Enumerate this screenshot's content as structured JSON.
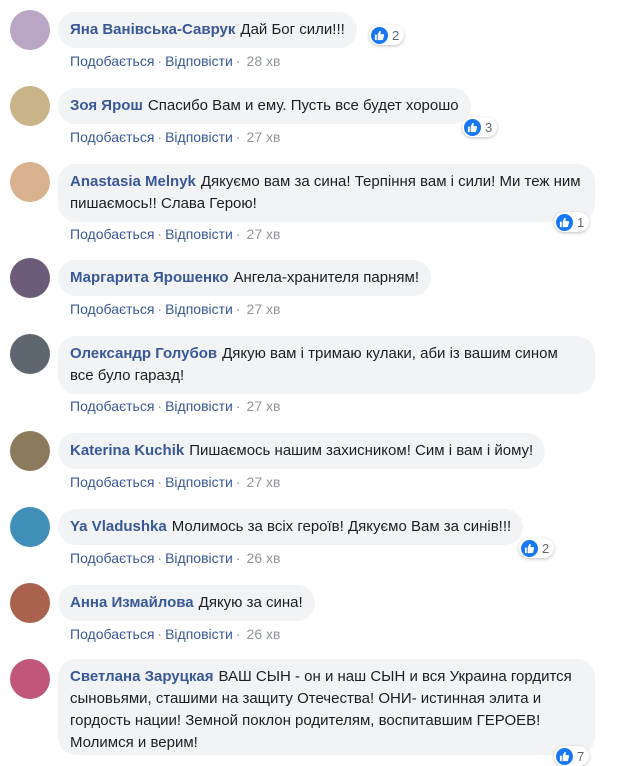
{
  "labels": {
    "like": "Подобається",
    "reply": "Відповісти",
    "sep": "·"
  },
  "comments": [
    {
      "author": "Яна Ванівська-Саврук",
      "text": "Дай Бог сили!!!",
      "time": "28 хв",
      "likes": "2",
      "avatar_color": "#b9a6c4"
    },
    {
      "author": "Зоя Ярош",
      "text": "Спасибо Вам и ему. Пусть все будет хорошо",
      "time": "27 хв",
      "likes": "3",
      "avatar_color": "#c9b48a"
    },
    {
      "author": "Anastasia Melnyk",
      "text": "Дякуємо вам за сина! Терпіння вам і сили! Ми теж ним пишаємось!! Слава Герою!",
      "time": "27 хв",
      "likes": "1",
      "avatar_color": "#d8b28f"
    },
    {
      "author": "Маргарита Ярошенко",
      "text": "Ангела-хранителя парням!",
      "time": "27 хв",
      "likes": "",
      "avatar_color": "#6b5a78"
    },
    {
      "author": "Олександр Голубов",
      "text": "Дякую вам і тримаю кулаки, аби із вашим сином все було гаразд!",
      "time": "27 хв",
      "likes": "",
      "avatar_color": "#5e6770"
    },
    {
      "author": "Katerina Kuchik",
      "text": "Пишаємось нашим захисником! Сим і вам і йому!",
      "time": "27 хв",
      "likes": "",
      "avatar_color": "#8c7a5c"
    },
    {
      "author": "Ya Vladushka",
      "text": "Молимось за всіх героїв! Дякуємо Вам за синів!!!",
      "time": "26 хв",
      "likes": "2",
      "avatar_color": "#3f8fb8"
    },
    {
      "author": "Анна Измайлова",
      "text": "Дякую за сина!",
      "time": "26 хв",
      "likes": "",
      "avatar_color": "#a8624e"
    },
    {
      "author": "Светлана Заруцкая",
      "text": "ВАШ СЫН - он и наш СЫН и вся Украина гордится сыновьями, сташими на защиту Отечества! ОНИ- истинная элита и гордость нации! Земной поклон родителям, воспитавшим ГЕРОЕВ! Молимся и верим!",
      "time": "",
      "likes": "7",
      "avatar_color": "#c0577a"
    }
  ]
}
